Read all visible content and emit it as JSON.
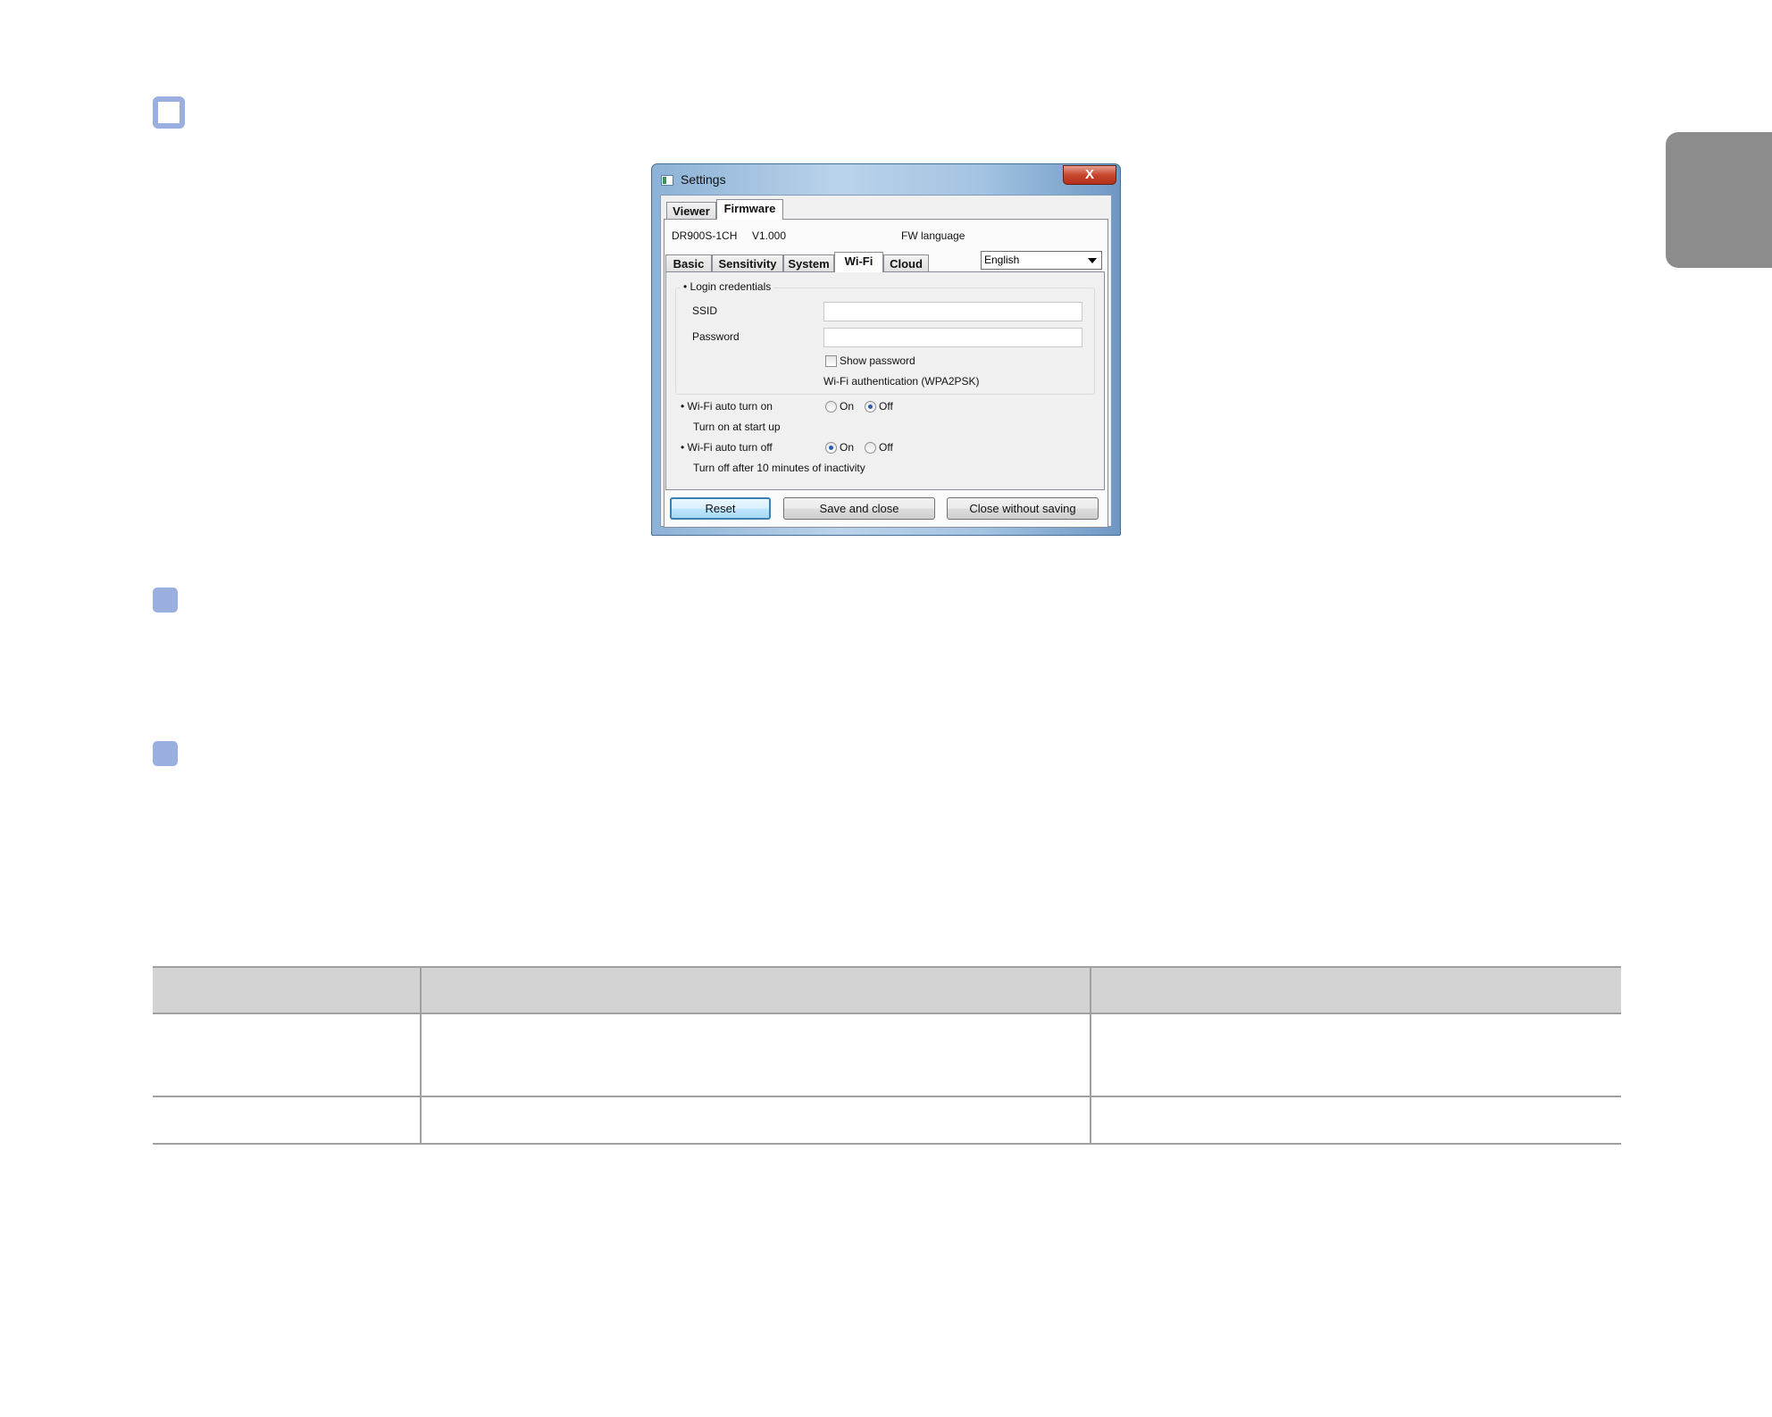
{
  "window": {
    "title": "Settings",
    "close_glyph": "X",
    "icon": "settings-app-icon"
  },
  "top_tabs": [
    {
      "label": "Viewer",
      "active": false
    },
    {
      "label": "Firmware",
      "active": true
    }
  ],
  "firmware_info": {
    "model": "DR900S-1CH",
    "version": "V1.000",
    "fw_language_label": "FW language",
    "fw_language_value": "English"
  },
  "sub_tabs": [
    {
      "label": "Basic",
      "active": false
    },
    {
      "label": "Sensitivity",
      "active": false
    },
    {
      "label": "System",
      "active": false
    },
    {
      "label": "Wi-Fi",
      "active": true
    },
    {
      "label": "Cloud",
      "active": false
    }
  ],
  "wifi": {
    "login_credentials_title": "Login credentials",
    "ssid_label": "SSID",
    "ssid_value": "",
    "password_label": "Password",
    "password_value": "",
    "show_password_label": "Show password",
    "show_password_checked": false,
    "auth_text": "Wi-Fi authentication (WPA2PSK)",
    "auto_on": {
      "label": "Wi-Fi auto turn on",
      "note": "Turn on at start up",
      "on_label": "On",
      "off_label": "Off",
      "selected": "Off"
    },
    "auto_off": {
      "label": "Wi-Fi auto turn off",
      "note": "Turn off after 10 minutes of inactivity",
      "on_label": "On",
      "off_label": "Off",
      "selected": "On"
    }
  },
  "buttons": {
    "reset": "Reset",
    "save_close": "Save and close",
    "close_no_save": "Close without saving"
  },
  "colors": {
    "step_marker": "#9aaee0",
    "side_tab": "#8c8c8c",
    "table_header": "#d3d3d3"
  }
}
